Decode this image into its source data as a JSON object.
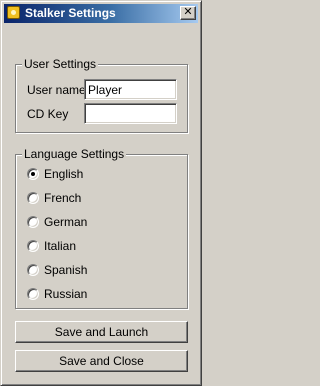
{
  "window": {
    "title": "Stalker Settings",
    "close_glyph": "✕"
  },
  "user_settings": {
    "legend": "User Settings",
    "user_name_label": "User name",
    "user_name_value": "Player",
    "cd_key_label": "CD Key",
    "cd_key_value": ""
  },
  "language_settings": {
    "legend": "Language Settings",
    "selected": "English",
    "options": [
      {
        "label": "English",
        "checked": true
      },
      {
        "label": "French",
        "checked": false
      },
      {
        "label": "German",
        "checked": false
      },
      {
        "label": "Italian",
        "checked": false
      },
      {
        "label": "Spanish",
        "checked": false
      },
      {
        "label": "Russian",
        "checked": false
      }
    ]
  },
  "buttons": {
    "save_and_launch": "Save and Launch",
    "save_and_close": "Save and Close"
  },
  "icons": {
    "app": "app-icon",
    "close": "close-icon"
  }
}
